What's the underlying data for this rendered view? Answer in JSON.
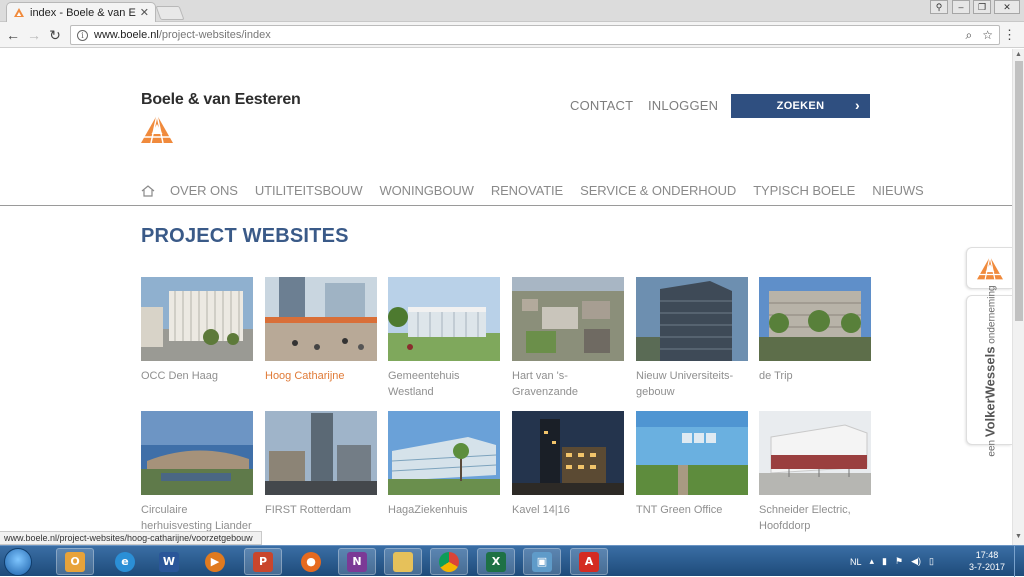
{
  "browser": {
    "tab_title": "index - Boele & van Eesten",
    "url_host": "www.boele.nl",
    "url_path": "/project-websites/index",
    "status_url": "www.boele.nl/project-websites/hoog-catharijne/voorzetgebouw"
  },
  "site": {
    "brand": "Boele & van Eesteren",
    "top_links": [
      "CONTACT",
      "INLOGGEN"
    ],
    "search_label": "ZOEKEN",
    "nav": [
      "OVER ONS",
      "UTILITEITSBOUW",
      "WONINGBOUW",
      "RENOVATIE",
      "SERVICE & ONDERHOUD",
      "TYPISCH BOELE",
      "NIEUWS"
    ],
    "page_title": "PROJECT WEBSITES",
    "projects": [
      {
        "line1": "OCC Den Haag",
        "line2": "",
        "active": false
      },
      {
        "line1": "Hoog Catharijne",
        "line2": "",
        "active": true
      },
      {
        "line1": "Gemeentehuis",
        "line2": "Westland",
        "active": false
      },
      {
        "line1": "Hart van 's-",
        "line2": "Gravenzande",
        "active": false
      },
      {
        "line1": "Nieuw Universiteits-",
        "line2": "gebouw",
        "active": false
      },
      {
        "line1": "de Trip",
        "line2": "",
        "active": false
      },
      {
        "line1": "Circulaire",
        "line2": "herhuisvesting Liander",
        "active": false
      },
      {
        "line1": "FIRST Rotterdam",
        "line2": "",
        "active": false
      },
      {
        "line1": "HagaZiekenhuis",
        "line2": "",
        "active": false
      },
      {
        "line1": "Kavel 14|16",
        "line2": "",
        "active": false
      },
      {
        "line1": "TNT Green Office",
        "line2": "",
        "active": false
      },
      {
        "line1": "Schneider Electric,",
        "line2": "Hoofddorp",
        "active": false
      }
    ],
    "side_widget": {
      "prefix": "een ",
      "brand": "VolkerWessels",
      "suffix": " onderneming"
    }
  },
  "taskbar": {
    "language": "NL",
    "time": "17:48",
    "date": "3-7-2017"
  },
  "colors": {
    "accent_blue": "#2f4f80",
    "title_blue": "#3a5a88",
    "brand_orange": "#f08a3c",
    "active_orange": "#e07b38"
  }
}
